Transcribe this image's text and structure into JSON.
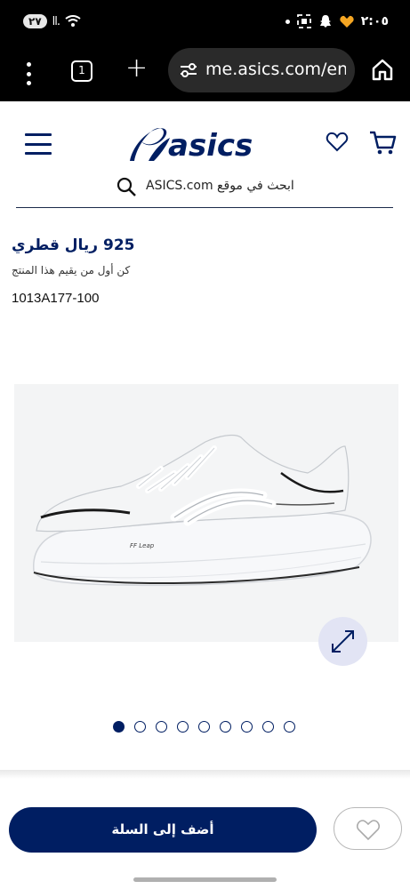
{
  "status_bar": {
    "notification_count": "٢٧",
    "signal": "ll.",
    "time": "٢:٠٥"
  },
  "browser": {
    "tab_count": "1",
    "url": "me.asics.com/en-"
  },
  "header": {
    "brand": "asics",
    "search_placeholder": "ابحث في موقع ASICS.com"
  },
  "product": {
    "price": "925 ريال قطري",
    "rating_prompt": "كن أول من يقيم هذا المنتج",
    "sku": "1013A177-100",
    "image_label": "FF Leap",
    "gallery": {
      "total_images": 9,
      "active_index": 0
    }
  },
  "actions": {
    "add_to_cart": "أضف إلى السلة"
  },
  "colors": {
    "brand_navy": "#001e62",
    "expand_bg": "#e2e4f4"
  }
}
